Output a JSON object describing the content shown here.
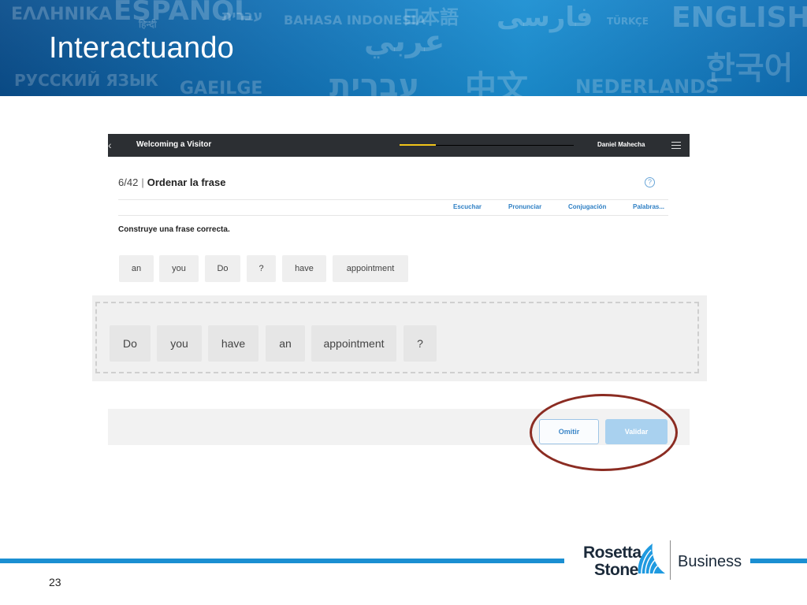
{
  "slide": {
    "title": "Interactuando",
    "number": "23",
    "background_words": [
      "ΕΛΛΗΝΙΚΑ",
      "ESPAÑOL",
      "עברית",
      "BAHASA INDONESIA",
      "日本語",
      "فارسی",
      "TÜRKÇE",
      "ENGLISH",
      "हिन्दी",
      "عربي",
      "РУССКИЙ ЯЗЫК",
      "GAEILGE",
      "עברית",
      "中文",
      "NEDERLANDS",
      "한국어"
    ]
  },
  "topbar": {
    "lesson_title": "Welcoming a Visitor",
    "user_name": "Daniel Mahecha",
    "progress_fraction": 0.21
  },
  "exercise": {
    "counter": "6/42",
    "separator": "|",
    "name": "Ordenar la frase",
    "help_glyph": "?",
    "tools": [
      "Escuchar",
      "Pronunciar",
      "Conjugación",
      "Palabras..."
    ],
    "instruction": "Construye una frase correcta."
  },
  "word_bank": [
    "an",
    "you",
    "Do",
    "?",
    "have",
    "appointment"
  ],
  "answer": [
    "Do",
    "you",
    "have",
    "an",
    "appointment",
    "?"
  ],
  "buttons": {
    "omit": "Omitir",
    "validate": "Validar"
  },
  "logo": {
    "line1": "Rosetta",
    "line2": "Stone",
    "product": "Business"
  },
  "colors": {
    "banner": "#1372b6",
    "accent_link": "#2e7fc4",
    "progress": "#f0c419",
    "highlight": "#8b2c22"
  }
}
